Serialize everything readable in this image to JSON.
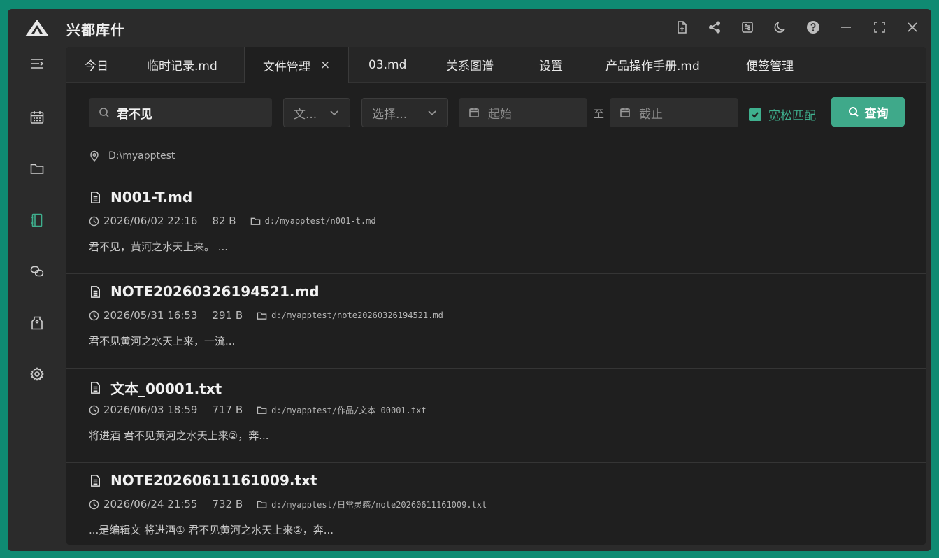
{
  "app": {
    "title": "兴都库什"
  },
  "colors": {
    "accent": "#3fb08e",
    "background": "#0f8a72",
    "window": "#2b2b2b",
    "panel": "#1f1f1f"
  },
  "titlebar_icons": [
    "new-file-icon",
    "share-icon",
    "settings-panel-icon",
    "moon-icon",
    "help-icon",
    "minimize-icon",
    "fullscreen-icon",
    "close-icon"
  ],
  "sidebar": {
    "items": [
      {
        "icon": "menu-toggle-icon"
      },
      {
        "icon": "calendar-icon"
      },
      {
        "icon": "folder-icon"
      },
      {
        "icon": "notebook-icon",
        "active": true
      },
      {
        "icon": "link-icon"
      },
      {
        "icon": "tag-icon"
      },
      {
        "icon": "gear-icon"
      }
    ]
  },
  "tabs": [
    {
      "label": "今日"
    },
    {
      "label": "临时记录.md"
    },
    {
      "label": "文件管理",
      "active": true,
      "close": "×"
    },
    {
      "label": "03.md"
    },
    {
      "label": "关系图谱"
    },
    {
      "label": "设置"
    },
    {
      "label": "产品操作手册.md"
    },
    {
      "label": "便签管理"
    }
  ],
  "search": {
    "keyword": "君不见",
    "type_select": "文...",
    "category_select": "选择...",
    "start_placeholder": "起始",
    "to_label": "至",
    "end_placeholder": "截止",
    "loose_match_label": "宽松匹配",
    "loose_match_checked": true,
    "query_button": "查询"
  },
  "root_path": "D:\\myapptest",
  "results": [
    {
      "name": "N001-T.md",
      "datetime": "2026/06/02 22:16",
      "size": "82 B",
      "path": "d:/myapptest/n001-t.md",
      "snippet": "君不见，黄河之水天上来。 ..."
    },
    {
      "name": "NOTE20260326194521.md",
      "datetime": "2026/05/31 16:53",
      "size": "291 B",
      "path": "d:/myapptest/note20260326194521.md",
      "snippet": "君不见黄河之水天上来，一流..."
    },
    {
      "name": "文本_00001.txt",
      "datetime": "2026/06/03 18:59",
      "size": "717 B",
      "path": "d:/myapptest/作品/文本_00001.txt",
      "snippet": "将进酒 君不见黄河之水天上来②，奔..."
    },
    {
      "name": "NOTE20260611161009.txt",
      "datetime": "2026/06/24 21:55",
      "size": "732 B",
      "path": "d:/myapptest/日常灵感/note20260611161009.txt",
      "snippet": "...是编辑文 将进酒① 君不见黄河之水天上来②，奔..."
    }
  ]
}
